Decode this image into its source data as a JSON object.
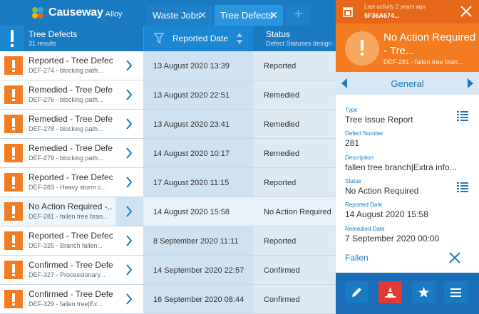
{
  "app": {
    "brand": "Causeway",
    "brand_sub": "Alloy"
  },
  "tabs": [
    {
      "label": "Waste Jobs",
      "close": "✕"
    },
    {
      "label": "Tree Defects",
      "close": "✕"
    }
  ],
  "tab_add": "+",
  "table": {
    "title": "Tree Defects",
    "count": "31 results",
    "columns": {
      "date": "Reported Date",
      "status": "Status",
      "status_sub": "Defect Statuses design"
    },
    "rows": [
      {
        "title": "Reported - Tree Defect",
        "sub": "DEF-274 - blocking path...",
        "date": "13 August 2020 13:39",
        "status": "Reported"
      },
      {
        "title": "Remedied - Tree Defect",
        "sub": "DEF-276 - blocking path...",
        "date": "13 August 2020 22:51",
        "status": "Remedied"
      },
      {
        "title": "Remedied - Tree Defect",
        "sub": "DEF-278 - blocking path...",
        "date": "13 August 2020 23:41",
        "status": "Remedied"
      },
      {
        "title": "Remedied - Tree Defect",
        "sub": "DEF-279 - blocking path...",
        "date": "14 August 2020 10:17",
        "status": "Remedied"
      },
      {
        "title": "Reported - Tree Defect",
        "sub": "DEF-283 - Heavy storm c...",
        "date": "17 August 2020 11:15",
        "status": "Reported"
      },
      {
        "title": "No Action Required -...",
        "sub": "DEF-281 - fallen tree bran...",
        "date": "14 August 2020 15:58",
        "status": "No Action Required"
      },
      {
        "title": "Reported - Tree Defect",
        "sub": "DEF-325 - Branch fallen...",
        "date": "8 September 2020 11:11",
        "status": "Reported"
      },
      {
        "title": "Confirmed - Tree Defe...",
        "sub": "DEF-327 - Processionary...",
        "date": "14 September 2020 22:57",
        "status": "Confirmed"
      },
      {
        "title": "Confirmed - Tree Defe...",
        "sub": "DEF-329 - fallen tree|Ex...",
        "date": "16 September 2020 08:44",
        "status": "Confirmed"
      }
    ]
  },
  "panel": {
    "last_activity": "Last activity 2 years ago",
    "record_id": "5F36A674...",
    "title": "No Action Required - Tre...",
    "subtitle": "DEF-281 - fallen tree bran...",
    "section": "General",
    "fields": [
      {
        "label": "Type",
        "value": "Tree Issue Report"
      },
      {
        "label": "Defect Number",
        "value": "281"
      },
      {
        "label": "Description",
        "value": "fallen tree branch|Extra info..."
      },
      {
        "label": "Status",
        "value": "No Action Required"
      },
      {
        "label": "Reported Date",
        "value": "14 August 2020 15:58"
      },
      {
        "label": "Remedied Date",
        "value": "7 September 2020 00:00"
      }
    ],
    "tag": "Fallen"
  },
  "colors": {
    "primary": "#1a7ac2",
    "accent": "#f47c20",
    "danger": "#e53935"
  }
}
